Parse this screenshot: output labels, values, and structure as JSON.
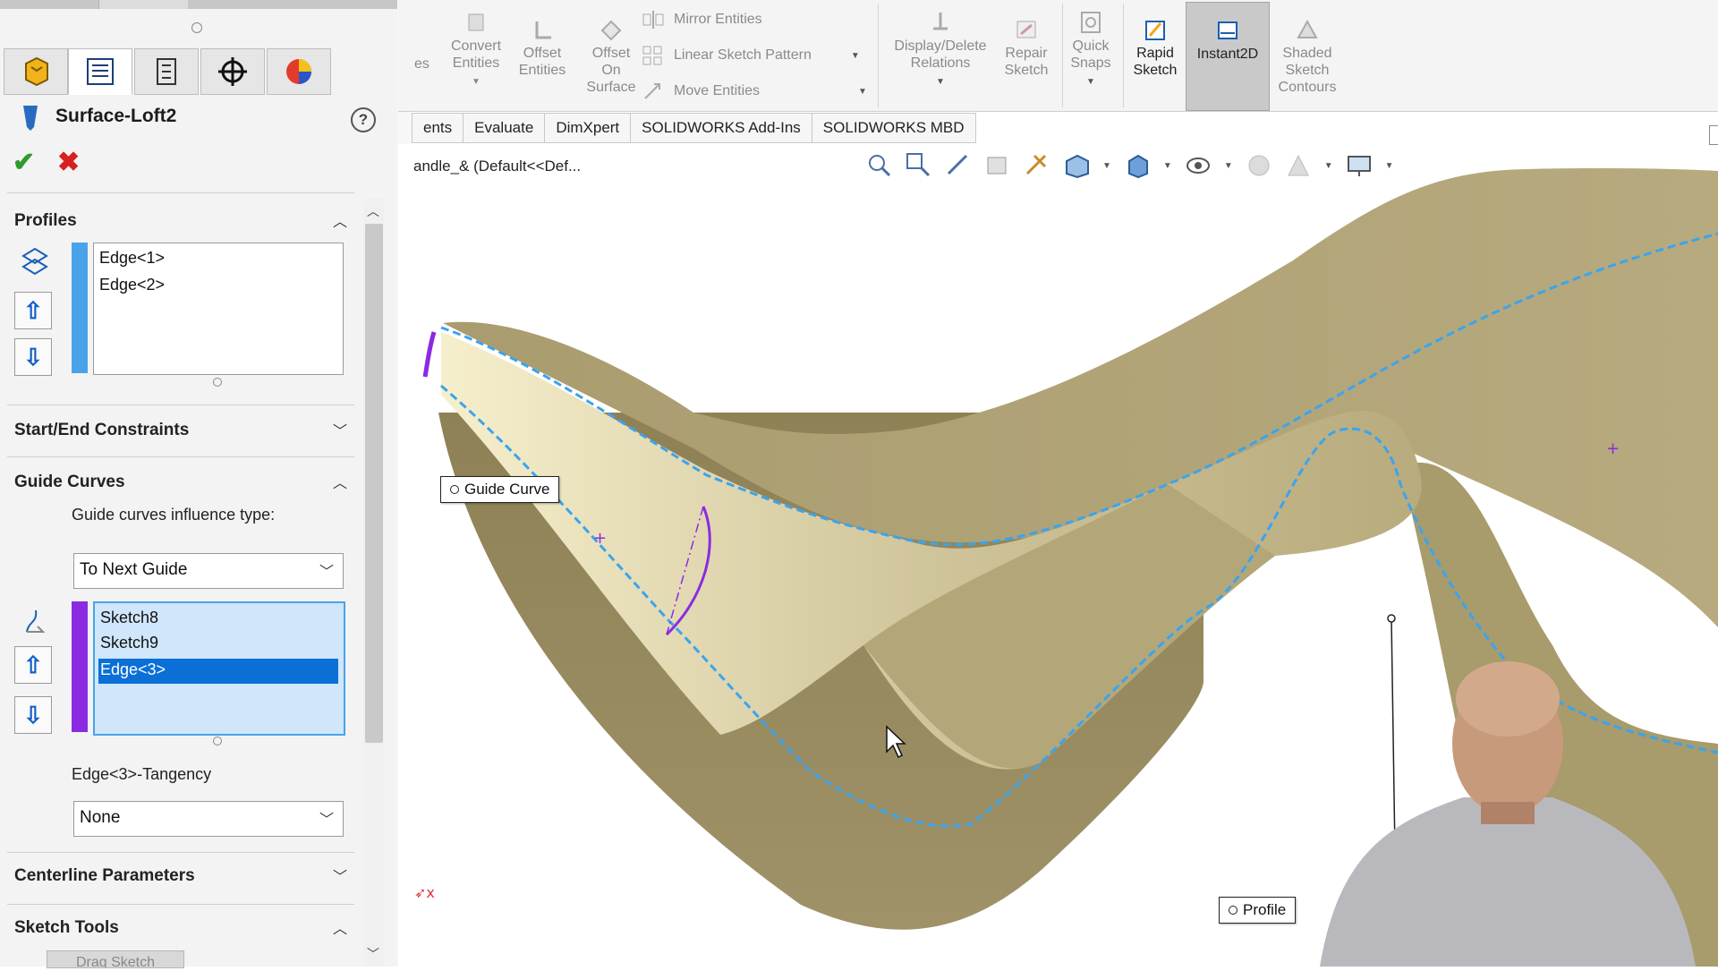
{
  "property_manager": {
    "feature_title": "Surface-Loft2",
    "profiles": {
      "header": "Profiles",
      "items": [
        "Edge<1>",
        "Edge<2>"
      ]
    },
    "start_end_constraints": {
      "header": "Start/End Constraints"
    },
    "guide_curves": {
      "header": "Guide Curves",
      "influence_label": "Guide curves influence type:",
      "influence_value": "To Next Guide",
      "items": [
        "Sketch8",
        "Sketch9",
        "Edge<3>"
      ],
      "selected_index": 2,
      "tangency_label": "Edge<3>-Tangency",
      "tangency_value": "None"
    },
    "centerline_parameters": {
      "header": "Centerline Parameters"
    },
    "sketch_tools": {
      "header": "Sketch Tools",
      "drag_sketch_label": "Drag Sketch"
    }
  },
  "ribbon": {
    "entities_partial": "es",
    "convert_entities": [
      "Convert",
      "Entities"
    ],
    "offset_entities": [
      "Offset",
      "Entities"
    ],
    "offset_on_surface": [
      "Offset",
      "On",
      "Surface"
    ],
    "mirror_entities": "Mirror Entities",
    "linear_sketch_pattern": "Linear Sketch Pattern",
    "move_entities": "Move Entities",
    "display_delete_relations": [
      "Display/Delete",
      "Relations"
    ],
    "repair_sketch": [
      "Repair",
      "Sketch"
    ],
    "quick_snaps": [
      "Quick",
      "Snaps"
    ],
    "rapid_sketch": [
      "Rapid",
      "Sketch"
    ],
    "instant2d": "Instant2D",
    "shaded_sketch_contours": [
      "Shaded",
      "Sketch",
      "Contours"
    ]
  },
  "command_tabs": [
    "ents",
    "Evaluate",
    "DimXpert",
    "SOLIDWORKS Add-Ins",
    "SOLIDWORKS MBD"
  ],
  "document_title": "andle_&  (Default<<Def...",
  "callouts": {
    "guide_curve": "Guide Curve",
    "profile": "Profile"
  },
  "colors": {
    "profile_bar": "#4aa3ea",
    "guide_bar": "#8a2be2",
    "selection": "#0a6fd6",
    "surface": "#a69a6b",
    "edge_dash": "#3aa4ee"
  }
}
